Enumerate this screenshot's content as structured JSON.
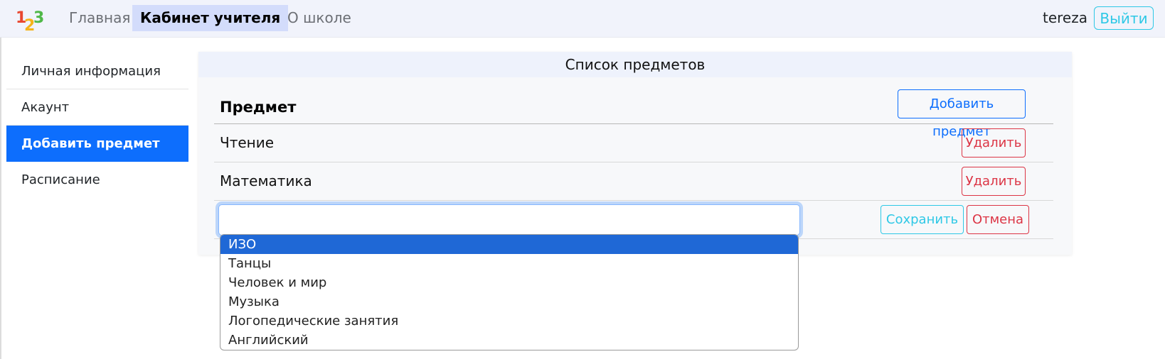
{
  "navbar": {
    "logo_text": "123",
    "links": [
      {
        "label": "Главная",
        "active": false
      },
      {
        "label": "Кабинет учителя",
        "active": true
      },
      {
        "label": "О школе",
        "active": false
      }
    ],
    "username": "tereza",
    "logout_label": "Выйти"
  },
  "sidebar": {
    "items": [
      {
        "label": "Личная информация",
        "active": false
      },
      {
        "label": "Акаунт",
        "active": false
      },
      {
        "label": "Добавить предмет",
        "active": true
      },
      {
        "label": "Расписание",
        "active": false
      }
    ]
  },
  "card": {
    "title": "Список предметов",
    "column_header": "Предмет",
    "add_button_label": "Добавить предмет",
    "subjects": [
      {
        "name": "Чтение",
        "delete_label": "Удалить"
      },
      {
        "name": "Математика",
        "delete_label": "Удалить"
      }
    ],
    "new_subject": {
      "value": "",
      "save_label": "Сохранить",
      "cancel_label": "Отмена"
    }
  },
  "dropdown": {
    "selected_index": 0,
    "options": [
      "ИЗО",
      "Танцы",
      "Человек и мир",
      "Музыка",
      "Логопедические занятия",
      "Английский"
    ]
  },
  "colors": {
    "primary": "#0d6efd",
    "danger": "#dc3545",
    "info": "#2ec8e6",
    "option_selected": "#1f68d6"
  }
}
